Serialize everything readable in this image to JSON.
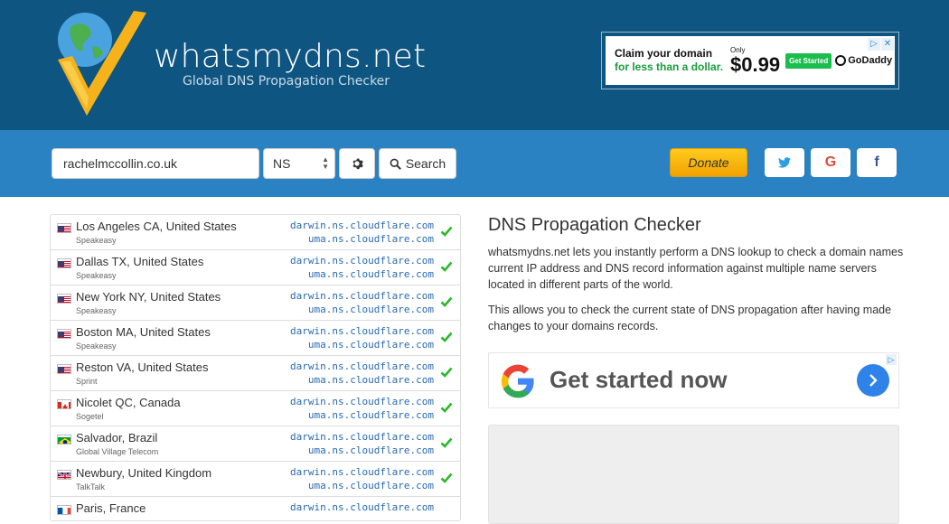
{
  "header": {
    "brand_title": "whatsmydns.net",
    "brand_subtitle": "Global DNS Propagation Checker"
  },
  "top_ad": {
    "line1": "Claim your domain",
    "line2": "for less than a dollar.",
    "only": "Only",
    "price": "$0.99",
    "cta": "Get Started",
    "advertiser": "GoDaddy",
    "adchoices_icons": [
      "adchoices-icon",
      "close-icon"
    ]
  },
  "search": {
    "domain_value": "rachelmccollin.co.uk",
    "record_type": "NS",
    "search_label": "Search",
    "donate_label": "Donate"
  },
  "social": {
    "twitter_icon": "t",
    "google_icon": "G",
    "facebook_icon": "f"
  },
  "results": [
    {
      "location": "Los Angeles CA, United States",
      "provider": "Speakeasy",
      "flag": "us",
      "ns1": "darwin.ns.cloudflare.com",
      "ns2": "uma.ns.cloudflare.com",
      "status": "ok"
    },
    {
      "location": "Dallas TX, United States",
      "provider": "Speakeasy",
      "flag": "us",
      "ns1": "darwin.ns.cloudflare.com",
      "ns2": "uma.ns.cloudflare.com",
      "status": "ok"
    },
    {
      "location": "New York NY, United States",
      "provider": "Speakeasy",
      "flag": "us",
      "ns1": "darwin.ns.cloudflare.com",
      "ns2": "uma.ns.cloudflare.com",
      "status": "ok"
    },
    {
      "location": "Boston MA, United States",
      "provider": "Speakeasy",
      "flag": "us",
      "ns1": "darwin.ns.cloudflare.com",
      "ns2": "uma.ns.cloudflare.com",
      "status": "ok"
    },
    {
      "location": "Reston VA, United States",
      "provider": "Sprint",
      "flag": "us",
      "ns1": "darwin.ns.cloudflare.com",
      "ns2": "uma.ns.cloudflare.com",
      "status": "ok"
    },
    {
      "location": "Nicolet QC, Canada",
      "provider": "Sogetel",
      "flag": "ca",
      "ns1": "darwin.ns.cloudflare.com",
      "ns2": "uma.ns.cloudflare.com",
      "status": "ok"
    },
    {
      "location": "Salvador, Brazil",
      "provider": "Global Village Telecom",
      "flag": "br",
      "ns1": "darwin.ns.cloudflare.com",
      "ns2": "uma.ns.cloudflare.com",
      "status": "ok"
    },
    {
      "location": "Newbury, United Kingdom",
      "provider": "TalkTalk",
      "flag": "gb",
      "ns1": "darwin.ns.cloudflare.com",
      "ns2": "uma.ns.cloudflare.com",
      "status": "ok"
    },
    {
      "location": "Paris, France",
      "provider": "",
      "flag": "fr",
      "ns1": "darwin.ns.cloudflare.com",
      "ns2": "",
      "status": ""
    }
  ],
  "info": {
    "title": "DNS Propagation Checker",
    "paragraph1": "whatsmydns.net lets you instantly perform a DNS lookup to check a domain names current IP address and DNS record information against multiple name servers located in different parts of the world.",
    "paragraph2": "This allows you to check the current state of DNS propagation after having made changes to your domains records."
  },
  "google_ad": {
    "text": "Get started now"
  },
  "colors": {
    "header_bg": "#0f5581",
    "searchbar_bg": "#2a82c2",
    "donate": "#f5b000",
    "ns_link": "#2a6ab0",
    "check": "#2db82d"
  }
}
